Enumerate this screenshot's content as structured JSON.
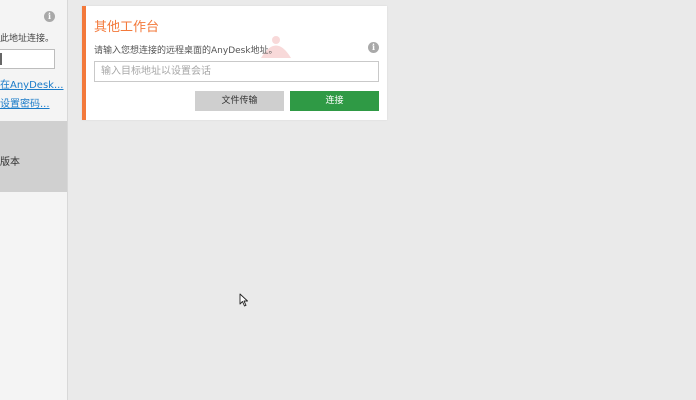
{
  "sidebar": {
    "text": "此地址连接。",
    "link1": "在AnyDesk...",
    "link2": "设置密码...",
    "version_label": "版本"
  },
  "panel": {
    "title": "其他工作台",
    "description": "请输入您想连接的远程桌面的AnyDesk地址。",
    "input_placeholder": "输入目标地址以设置会话",
    "file_transfer_label": "文件传输",
    "connect_label": "连接"
  },
  "colors": {
    "accent": "#f3793b",
    "connect": "#2f9a45",
    "link": "#1a7bc9"
  },
  "icons": [
    "info-icon",
    "mouse-cursor-icon"
  ]
}
